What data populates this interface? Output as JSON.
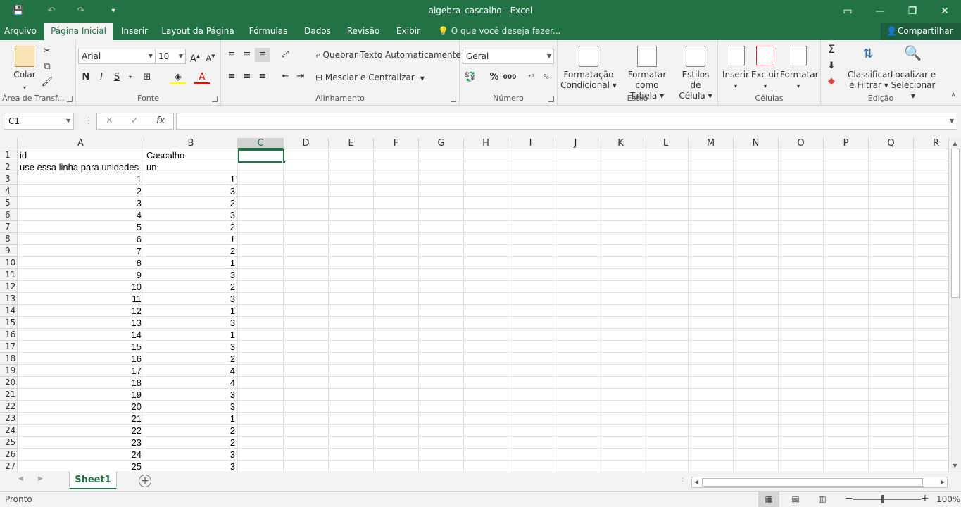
{
  "titlebar": {
    "title": "algebra_cascalho - Excel"
  },
  "tabs": {
    "file": "Arquivo",
    "home": "Página Inicial",
    "insert": "Inserir",
    "layout": "Layout da Página",
    "formulas": "Fórmulas",
    "data": "Dados",
    "review": "Revisão",
    "view": "Exibir",
    "tell_me": "O que você deseja fazer...",
    "share": "Compartilhar"
  },
  "ribbon": {
    "clipboard": {
      "paste": "Colar",
      "label": "Área de Transf..."
    },
    "font": {
      "name": "Arial",
      "size": "10",
      "bold": "N",
      "italic": "I",
      "underline": "S",
      "label": "Fonte"
    },
    "alignment": {
      "wrap": "Quebrar Texto Automaticamente",
      "merge": "Mesclar e Centralizar",
      "label": "Alinhamento"
    },
    "number": {
      "format": "Geral",
      "percent": "%",
      "thousands": "000",
      "label": "Número"
    },
    "styles": {
      "conditional_1": "Formatação",
      "conditional_2": "Condicional",
      "table_1": "Formatar como",
      "table_2": "Tabela",
      "cell_1": "Estilos de",
      "cell_2": "Célula",
      "label": "Estilo"
    },
    "cells": {
      "insert": "Inserir",
      "delete": "Excluir",
      "format": "Formatar",
      "label": "Células"
    },
    "editing": {
      "sort_1": "Classificar",
      "sort_2": "e Filtrar",
      "find_1": "Localizar e",
      "find_2": "Selecionar",
      "label": "Edição"
    }
  },
  "formula_bar": {
    "name_box": "C1",
    "fx": "fx",
    "value": ""
  },
  "sheet": {
    "columns": [
      "A",
      "B",
      "C",
      "D",
      "E",
      "F",
      "G",
      "H",
      "I",
      "J",
      "K",
      "L",
      "M",
      "N",
      "O",
      "P",
      "Q",
      "R"
    ],
    "selected_column": "C",
    "rows": [
      {
        "n": "1",
        "a": "id",
        "b": "Cascalho"
      },
      {
        "n": "2",
        "a": "use essa linha para unidades",
        "b": "un"
      },
      {
        "n": "3",
        "a": "1",
        "b": "1"
      },
      {
        "n": "4",
        "a": "2",
        "b": "3"
      },
      {
        "n": "5",
        "a": "3",
        "b": "2"
      },
      {
        "n": "6",
        "a": "4",
        "b": "3"
      },
      {
        "n": "7",
        "a": "5",
        "b": "2"
      },
      {
        "n": "8",
        "a": "6",
        "b": "1"
      },
      {
        "n": "9",
        "a": "7",
        "b": "2"
      },
      {
        "n": "10",
        "a": "8",
        "b": "1"
      },
      {
        "n": "11",
        "a": "9",
        "b": "3"
      },
      {
        "n": "12",
        "a": "10",
        "b": "2"
      },
      {
        "n": "13",
        "a": "11",
        "b": "3"
      },
      {
        "n": "14",
        "a": "12",
        "b": "1"
      },
      {
        "n": "15",
        "a": "13",
        "b": "3"
      },
      {
        "n": "16",
        "a": "14",
        "b": "1"
      },
      {
        "n": "17",
        "a": "15",
        "b": "3"
      },
      {
        "n": "18",
        "a": "16",
        "b": "2"
      },
      {
        "n": "19",
        "a": "17",
        "b": "4"
      },
      {
        "n": "20",
        "a": "18",
        "b": "4"
      },
      {
        "n": "21",
        "a": "19",
        "b": "3"
      },
      {
        "n": "22",
        "a": "20",
        "b": "3"
      },
      {
        "n": "23",
        "a": "21",
        "b": "1"
      },
      {
        "n": "24",
        "a": "22",
        "b": "2"
      },
      {
        "n": "25",
        "a": "23",
        "b": "2"
      },
      {
        "n": "26",
        "a": "24",
        "b": "3"
      },
      {
        "n": "27",
        "a": "25",
        "b": "3"
      }
    ]
  },
  "sheet_tabs": {
    "active": "Sheet1",
    "add": "+"
  },
  "status": {
    "ready": "Pronto",
    "zoom": "100%"
  },
  "colors": {
    "excel_green": "#217346"
  }
}
